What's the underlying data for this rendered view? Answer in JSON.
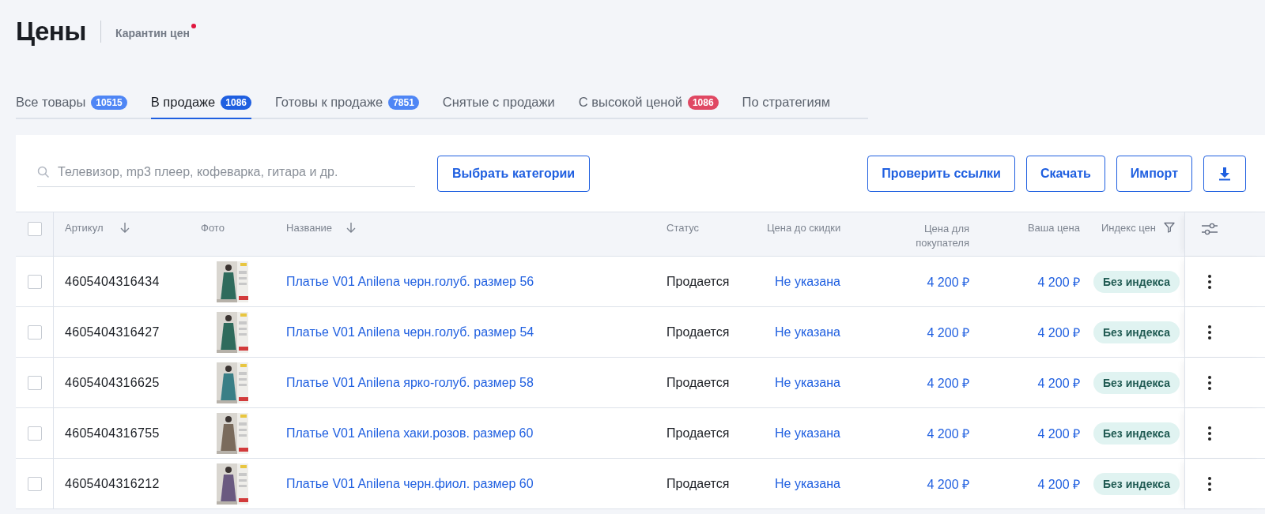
{
  "title": "Цены",
  "quarantine": {
    "label": "Карантин цен",
    "alert": true
  },
  "tabs": [
    {
      "label": "Все товары",
      "count": "10515",
      "color": "#4f86f5",
      "selected": false
    },
    {
      "label": "В продаже",
      "count": "1086",
      "color": "#1f5fe0",
      "selected": true
    },
    {
      "label": "Готовы к продаже",
      "count": "7851",
      "color": "#4f86f5",
      "selected": false
    },
    {
      "label": "Снятые с продажи",
      "selected": false
    },
    {
      "label": "С высокой ценой",
      "count": "1086",
      "color": "#e04863",
      "selected": false
    },
    {
      "label": "По стратегиям",
      "selected": false
    }
  ],
  "search": {
    "placeholder": "Телевизор, mp3 плеер, кофеварка, гитара и др."
  },
  "category_button": "Выбрать категории",
  "actions": [
    "Проверить ссылки",
    "Скачать",
    "Импорт"
  ],
  "table": {
    "select_all": {
      "checked": false
    },
    "columns": [
      {
        "label": "Артикул",
        "sortable": true
      },
      {
        "label": "Фото",
        "sortable": false
      },
      {
        "label": "Название",
        "sortable": true
      },
      {
        "label": "Статус",
        "sortable": false
      },
      {
        "label": "Цена до скидки",
        "sortable": false
      },
      {
        "label": "Цена для покупателя",
        "sortable": false
      },
      {
        "label": "Ваша цена",
        "sortable": false
      },
      {
        "label": "Индекс цен",
        "sortable": false,
        "filter": true
      }
    ],
    "rows": [
      {
        "checked": false,
        "sku": "4605404316434",
        "name": "Платье V01 Anilena черн.голуб. размер 56",
        "status": "Продается",
        "old_price": "Не указана",
        "buyer_price": "4 200 ₽",
        "your_price": "4 200 ₽",
        "index": "Без индекса",
        "color": "#2f6b5c"
      },
      {
        "checked": false,
        "sku": "4605404316427",
        "name": "Платье V01 Anilena черн.голуб. размер 54",
        "status": "Продается",
        "old_price": "Не указана",
        "buyer_price": "4 200 ₽",
        "your_price": "4 200 ₽",
        "index": "Без индекса",
        "color": "#2f6b5c"
      },
      {
        "checked": false,
        "sku": "4605404316625",
        "name": "Платье V01 Anilena ярко-голуб. размер 58",
        "status": "Продается",
        "old_price": "Не указана",
        "buyer_price": "4 200 ₽",
        "your_price": "4 200 ₽",
        "index": "Без индекса",
        "color": "#3a7f86"
      },
      {
        "checked": false,
        "sku": "4605404316755",
        "name": "Платье V01 Anilena хаки.розов. размер 60",
        "status": "Продается",
        "old_price": "Не указана",
        "buyer_price": "4 200 ₽",
        "your_price": "4 200 ₽",
        "index": "Без индекса",
        "color": "#7a6b5c"
      },
      {
        "checked": false,
        "sku": "4605404316212",
        "name": "Платье V01 Anilena черн.фиол. размер 60",
        "status": "Продается",
        "old_price": "Не указана",
        "buyer_price": "4 200 ₽",
        "your_price": "4 200 ₽",
        "index": "Без индекса",
        "color": "#6a5a80"
      }
    ]
  }
}
